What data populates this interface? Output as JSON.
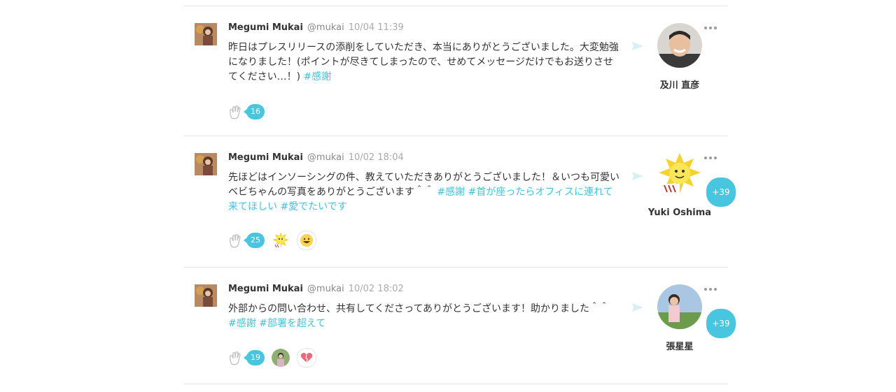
{
  "colors": {
    "accent": "#48c6df",
    "hashtag": "#3fc3dc",
    "divider": "#e6e6e6"
  },
  "posts": [
    {
      "sender": {
        "name": "Megumi Mukai",
        "handle": "@mukai",
        "time": "10/04 11:39"
      },
      "message": "昨日はプレスリリースの添削をしていただき、本当にありがとうございました。大変勉強になりました！(ポイントが尽きてしまったので、せめてメッセージだけでもお送りさせてください…！)",
      "tags": "#感謝",
      "recipient": {
        "name": "及川 直彦",
        "extra": ""
      },
      "clap_count": "16",
      "reactions": []
    },
    {
      "sender": {
        "name": "Megumi Mukai",
        "handle": "@mukai",
        "time": "10/02 18:04"
      },
      "message": "先ほどはインソーシングの件、教えていただきありがとうございました！＆いつも可愛いベビちゃんの写真をありがとうございます＾＾",
      "tags": "#感謝 #首が座ったらオフィスに連れて来てほしい #愛でたいです",
      "recipient": {
        "name": "Yuki Oshima",
        "extra": "+39"
      },
      "clap_count": "25",
      "reactions": [
        "sun-character-icon",
        "grinning-face-icon"
      ]
    },
    {
      "sender": {
        "name": "Megumi Mukai",
        "handle": "@mukai",
        "time": "10/02 18:02"
      },
      "message": "外部からの問い合わせ、共有してくださってありがとうございます！助かりました＾＾",
      "tags": "#感謝 #部署を超えて",
      "recipient": {
        "name": "張星星",
        "extra": "+39"
      },
      "clap_count": "19",
      "reactions": [
        "user-photo",
        "heart-icon"
      ]
    }
  ]
}
